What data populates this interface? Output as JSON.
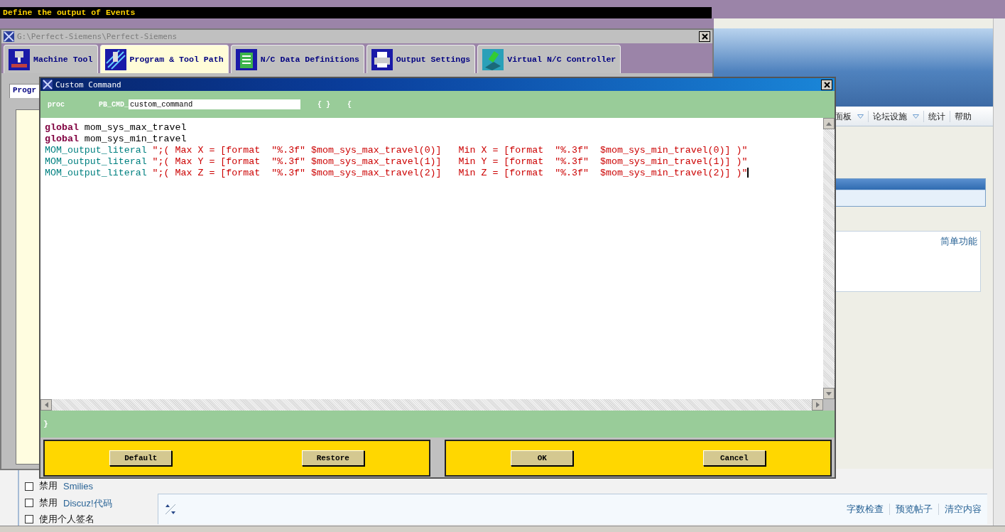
{
  "banner": {
    "title": "Define the output of Events"
  },
  "main_window": {
    "title": "G:\\Perfect-Siemens\\Perfect-Siemens",
    "tabs": [
      {
        "label": "Machine Tool",
        "selected": false,
        "kind": "mill"
      },
      {
        "label": "Program & Tool Path",
        "selected": true,
        "kind": "toolpath"
      },
      {
        "label": "N/C Data Definitions",
        "selected": false,
        "kind": "data"
      },
      {
        "label": "Output Settings",
        "selected": false,
        "kind": "printer"
      },
      {
        "label": "Virtual N/C Controller",
        "selected": false,
        "kind": "cube"
      }
    ],
    "subtab": {
      "label": "Progr",
      "selected": true
    }
  },
  "dialog": {
    "title": "Custom Command",
    "header": {
      "proc_label": "proc",
      "prefix": "PB_CMD_",
      "name_value": "custom_command",
      "braces": "{ }",
      "open_brace": "{"
    },
    "code_lines": [
      {
        "caret": false,
        "tokens": [
          {
            "kind": "keyword",
            "text": "global"
          },
          {
            "kind": "plain",
            "text": " mom_sys_max_travel"
          }
        ]
      },
      {
        "caret": false,
        "tokens": [
          {
            "kind": "keyword",
            "text": "global"
          },
          {
            "kind": "plain",
            "text": " mom_sys_min_travel"
          }
        ]
      },
      {
        "caret": false,
        "tokens": [
          {
            "kind": "command",
            "text": "MOM_output_literal"
          },
          {
            "kind": "string",
            "text": " \";( Max X = [format  \"%.3f\" $mom_sys_max_travel(0)]   Min X = [format  \"%.3f\"  $mom_sys_min_travel(0)] )\""
          }
        ]
      },
      {
        "caret": false,
        "tokens": [
          {
            "kind": "command",
            "text": "MOM_output_literal"
          },
          {
            "kind": "string",
            "text": " \";( Max Y = [format  \"%.3f\" $mom_sys_max_travel(1)]   Min Y = [format  \"%.3f\"  $mom_sys_min_travel(1)] )\""
          }
        ]
      },
      {
        "caret": true,
        "tokens": [
          {
            "kind": "command",
            "text": "MOM_output_literal"
          },
          {
            "kind": "string",
            "text": " \";( Max Z = [format  \"%.3f\" $mom_sys_max_travel(2)]   Min Z = [format  \"%.3f\"  $mom_sys_min_travel(2)] )\""
          }
        ]
      }
    ],
    "closing_brace": "}",
    "left_buttons": [
      "Default",
      "Restore"
    ],
    "right_buttons": [
      "OK",
      "Cancel"
    ]
  },
  "forum": {
    "menu": [
      {
        "label": "面板",
        "dropdown": true
      },
      {
        "label": "论坛设施",
        "dropdown": true
      },
      {
        "label": "统计",
        "dropdown": false
      },
      {
        "label": "帮助",
        "dropdown": false
      }
    ],
    "mode_link": "简单功能",
    "options": [
      {
        "label": "禁用",
        "link": "Smilies",
        "checked": false
      },
      {
        "label": "禁用",
        "link": "Discuz!代码",
        "checked": false
      },
      {
        "label": "使用个人签名",
        "checked": false
      }
    ],
    "actions": [
      "字数检查",
      "预览帖子",
      "清空内容"
    ]
  }
}
